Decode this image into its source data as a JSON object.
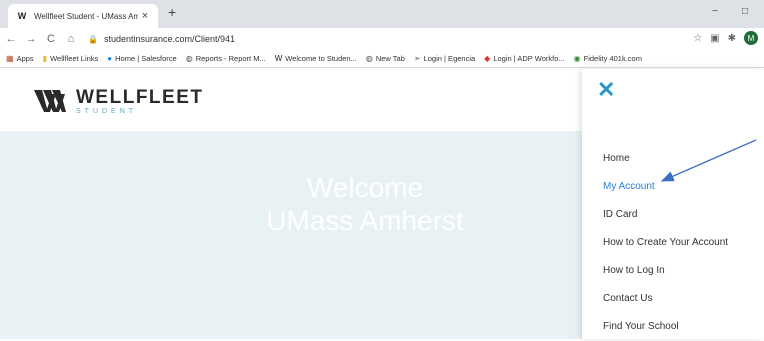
{
  "browser": {
    "tab_title": "Wellfleet Student - UMass Amhe",
    "tab_favicon": "W",
    "close_glyph": "×",
    "newtab_glyph": "+",
    "minimize_glyph": "−",
    "restore_glyph": "□",
    "back_glyph": "←",
    "forward_glyph": "→",
    "reload_glyph": "C",
    "home_glyph": "⌂",
    "lock_glyph": "🔒",
    "url": "studentinsurance.com/Client/941",
    "star_glyph": "☆",
    "ext1_glyph": "▣",
    "ext2_glyph": "✱",
    "avatar_letter": "M",
    "avatar_color": "#1e6b3a"
  },
  "bookmarks": [
    {
      "icon": "apps-grid-icon",
      "glyph": "▦",
      "label": "Apps",
      "color": "#c04a2b"
    },
    {
      "icon": "folder-icon",
      "glyph": "▮",
      "label": "Wellfleet Links",
      "color": "#e6b93a"
    },
    {
      "icon": "salesforce-cloud-icon",
      "glyph": "●",
      "label": "Home | Salesforce",
      "color": "#1e8ad6"
    },
    {
      "icon": "globe-icon",
      "glyph": "◍",
      "label": "Reports - Report M...",
      "color": "#555"
    },
    {
      "icon": "wellfleet-icon",
      "glyph": "W",
      "label": "Welcome to Studen...",
      "color": "#222"
    },
    {
      "icon": "globe-icon",
      "glyph": "◍",
      "label": "New Tab",
      "color": "#555"
    },
    {
      "icon": "egencia-icon",
      "glyph": "➣",
      "label": "Login | Egencia",
      "color": "#555"
    },
    {
      "icon": "adp-icon",
      "glyph": "◆",
      "label": "Login | ADP Workfo...",
      "color": "#d33"
    },
    {
      "icon": "fidelity-icon",
      "glyph": "◉",
      "label": "Fidelity 401k.com",
      "color": "#3a8a3a"
    }
  ],
  "site": {
    "logo_word": "WELLFLEET",
    "logo_sub": "STUDENT",
    "hero_title": "Welcome",
    "hero_sub": "UMass Amherst"
  },
  "menu": {
    "close_glyph": "✕",
    "items": [
      {
        "label": "Home",
        "active": false
      },
      {
        "label": "My Account",
        "active": true
      },
      {
        "label": "ID Card",
        "active": false
      },
      {
        "label": "How to Create Your Account",
        "active": false
      },
      {
        "label": "How to Log In",
        "active": false
      },
      {
        "label": "Contact Us",
        "active": false
      },
      {
        "label": "Find Your School",
        "active": false
      }
    ]
  },
  "colors": {
    "accent": "#2896c7",
    "arrow": "#3a6fc4",
    "hero_bg": "#e8f2f4",
    "active_link": "#2a7fd4"
  }
}
